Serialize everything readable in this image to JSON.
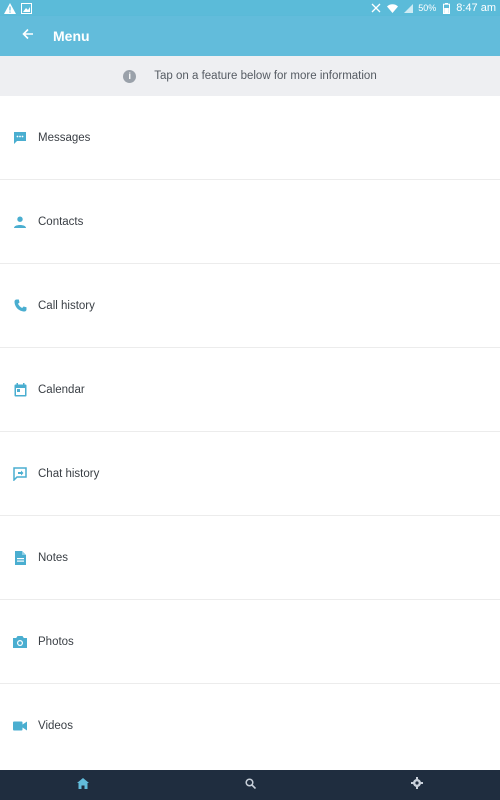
{
  "status_bar": {
    "battery": "50%",
    "time": "8:47 am"
  },
  "app_bar": {
    "title": "Menu",
    "back_icon": "back-arrow-icon"
  },
  "info_banner": {
    "text": "Tap on a feature below for more information",
    "icon": "info-icon"
  },
  "menu": {
    "items": [
      {
        "label": "Messages",
        "icon": "message-icon"
      },
      {
        "label": "Contacts",
        "icon": "person-icon"
      },
      {
        "label": "Call history",
        "icon": "phone-icon"
      },
      {
        "label": "Calendar",
        "icon": "calendar-icon"
      },
      {
        "label": "Chat history",
        "icon": "chat-icon"
      },
      {
        "label": "Notes",
        "icon": "note-icon"
      },
      {
        "label": "Photos",
        "icon": "camera-icon"
      },
      {
        "label": "Videos",
        "icon": "video-icon"
      }
    ]
  },
  "bottom_nav": {
    "items": [
      {
        "icon": "home-icon"
      },
      {
        "icon": "search-icon"
      },
      {
        "icon": "settings-icon"
      }
    ]
  },
  "colors": {
    "accent": "#62bcdb",
    "icon": "#4aaed0",
    "nav_bg": "#1f2d3f",
    "banner_bg": "#eeeff2"
  }
}
